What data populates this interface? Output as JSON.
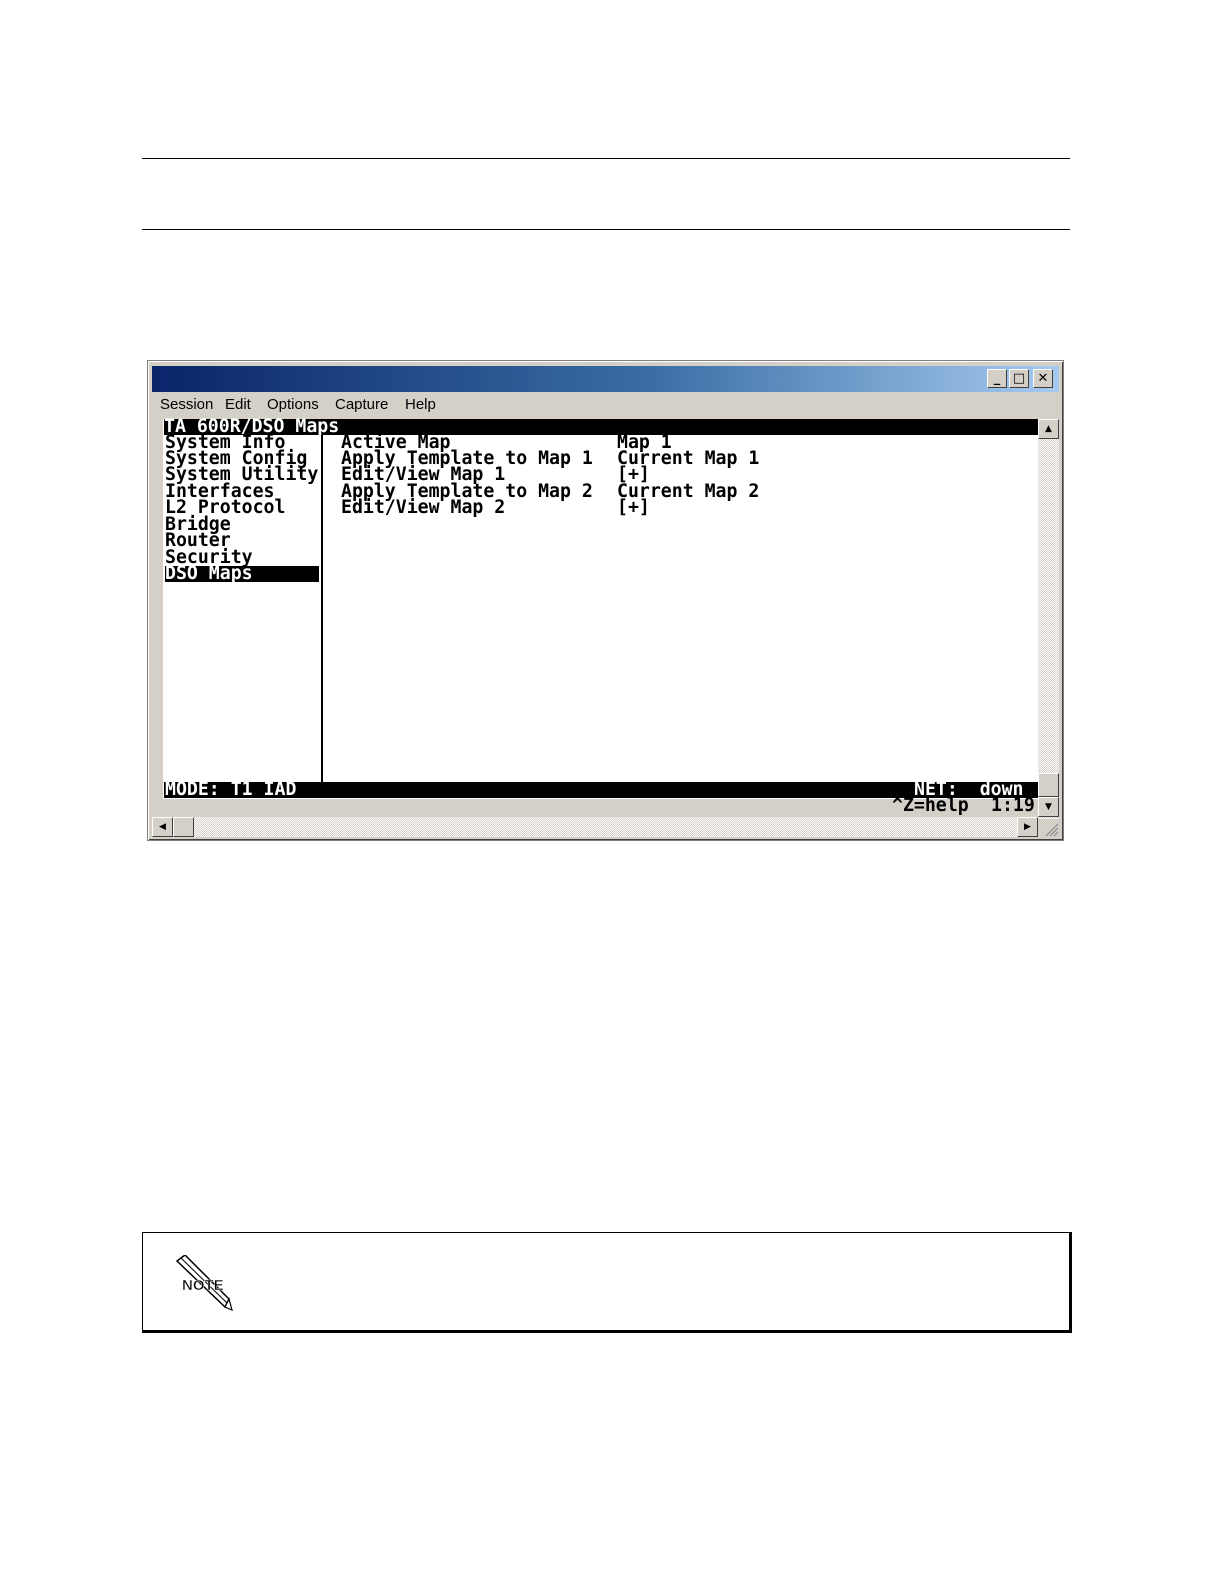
{
  "window": {
    "buttons": {
      "minimize": "_",
      "maximize": "□",
      "close": "✕"
    },
    "menu": [
      "Session",
      "Edit",
      "Options",
      "Capture",
      "Help"
    ]
  },
  "terminal": {
    "header": "TA 600R/DSO Maps",
    "nav": [
      "System Info",
      "System Config",
      "System Utility",
      "Interfaces",
      "L2 Protocol",
      "Bridge",
      "Router",
      "Security",
      "DSO Maps"
    ],
    "selected_nav_index": 8,
    "rows": [
      {
        "label": "Active Map",
        "value": "Map 1"
      },
      {
        "label": "Apply Template to Map 1",
        "value": "Current Map 1"
      },
      {
        "label": "Edit/View Map 1",
        "value": "[+]"
      },
      {
        "label": "Apply Template to Map 2",
        "value": "Current Map 2"
      },
      {
        "label": "Edit/View Map 2",
        "value": "[+]"
      }
    ],
    "status_mode": "MODE: T1 IAD",
    "status_net": "NET:  down",
    "help_hint": "^Z=help",
    "clock": "1:19"
  },
  "scrollbar_icons": {
    "up": "▲",
    "down": "▼",
    "left": "◀",
    "right": "▶"
  },
  "note": {
    "icon_label": "NOTE",
    "icon": "note-pencil-icon"
  }
}
